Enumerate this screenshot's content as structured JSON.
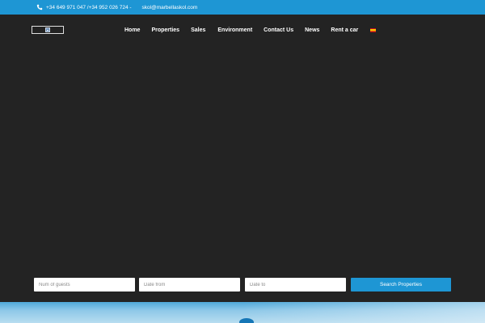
{
  "topbar": {
    "phone_icon": "phone-icon",
    "phones": "+34 649 971 047 /+34 952 026 724 -",
    "email": "skol@marbellaskol.com",
    "background_color": "#1e96d4"
  },
  "header": {
    "logo_icon": "logo-image-icon",
    "nav": {
      "items": [
        {
          "label": "Home"
        },
        {
          "label": "Properties"
        },
        {
          "label": "Sales"
        },
        {
          "label": "Environment"
        },
        {
          "label": "Contact Us"
        },
        {
          "label": "News"
        },
        {
          "label": "Rent a car"
        }
      ],
      "language_icon": "spanish-flag-icon"
    }
  },
  "search": {
    "guests_placeholder": "Num of guests",
    "date_from_placeholder": "Date from",
    "date_to_placeholder": "Date to",
    "button_label": "Search Properties",
    "button_color": "#1e96d4"
  },
  "page": {
    "background_color": "#232323"
  }
}
